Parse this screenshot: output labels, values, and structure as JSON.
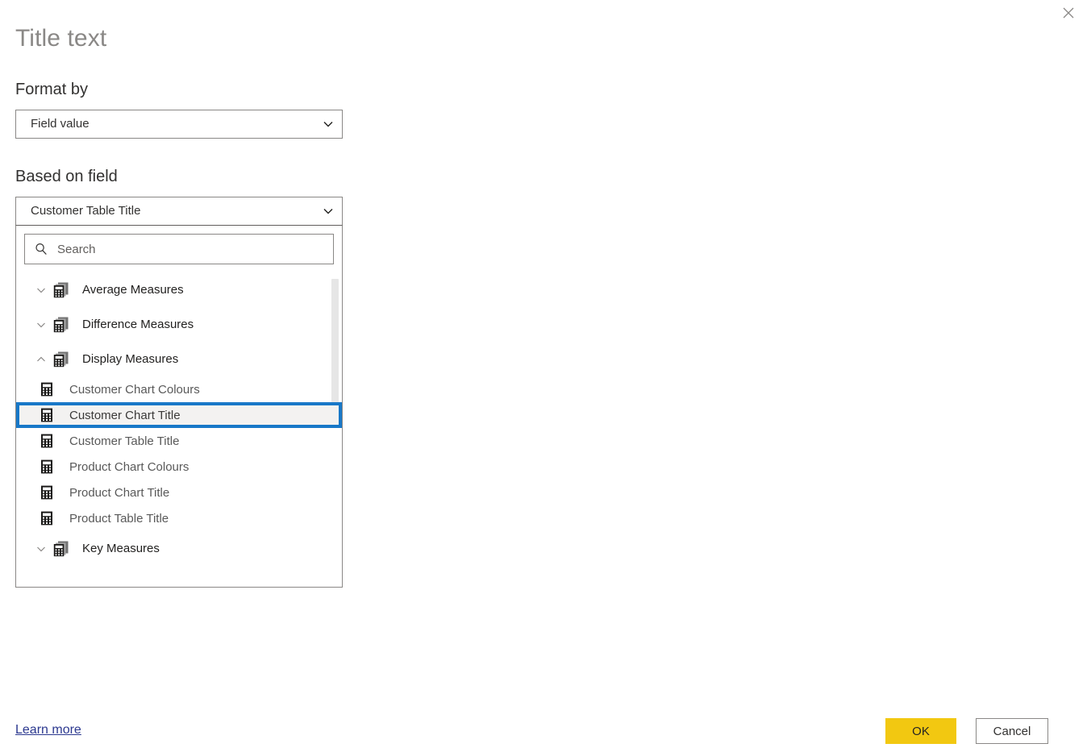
{
  "dialog": {
    "title": "Title text",
    "close_icon": "close-icon"
  },
  "format_by": {
    "label": "Format by",
    "selected": "Field value",
    "chevron_icon": "chevron-down-icon"
  },
  "based_on_field": {
    "label": "Based on field",
    "selected": "Customer Table Title",
    "chevron_icon": "chevron-down-icon"
  },
  "search": {
    "placeholder": "Search",
    "value": "",
    "icon": "search-icon"
  },
  "tree": {
    "items": [
      {
        "label": "Average Measures",
        "type": "group",
        "expanded": false,
        "icon": "measure-group-icon",
        "chevron": "chevron-down-icon"
      },
      {
        "label": "Difference Measures",
        "type": "group",
        "expanded": false,
        "icon": "measure-group-icon",
        "chevron": "chevron-down-icon"
      },
      {
        "label": "Display Measures",
        "type": "group",
        "expanded": true,
        "icon": "measure-group-icon",
        "chevron": "chevron-up-icon"
      },
      {
        "label": "Customer Chart Colours",
        "type": "leaf",
        "selected": false,
        "icon": "measure-icon"
      },
      {
        "label": "Customer Chart Title",
        "type": "leaf",
        "selected": true,
        "icon": "measure-icon"
      },
      {
        "label": "Customer Table Title",
        "type": "leaf",
        "selected": false,
        "icon": "measure-icon"
      },
      {
        "label": "Product Chart Colours",
        "type": "leaf",
        "selected": false,
        "icon": "measure-icon"
      },
      {
        "label": "Product Chart Title",
        "type": "leaf",
        "selected": false,
        "icon": "measure-icon"
      },
      {
        "label": "Product Table Title",
        "type": "leaf",
        "selected": false,
        "icon": "measure-icon"
      },
      {
        "label": "Key Measures",
        "type": "group",
        "expanded": false,
        "icon": "measure-group-icon",
        "chevron": "chevron-down-icon"
      }
    ]
  },
  "footer": {
    "learn_more": "Learn more",
    "ok": "OK",
    "cancel": "Cancel"
  },
  "colors": {
    "selection_border": "#1878c8",
    "selection_fill": "#f3f2f1",
    "primary_button": "#f2c811",
    "link": "#2b388f",
    "border": "#8a8886",
    "title_text": "#8a8886"
  }
}
